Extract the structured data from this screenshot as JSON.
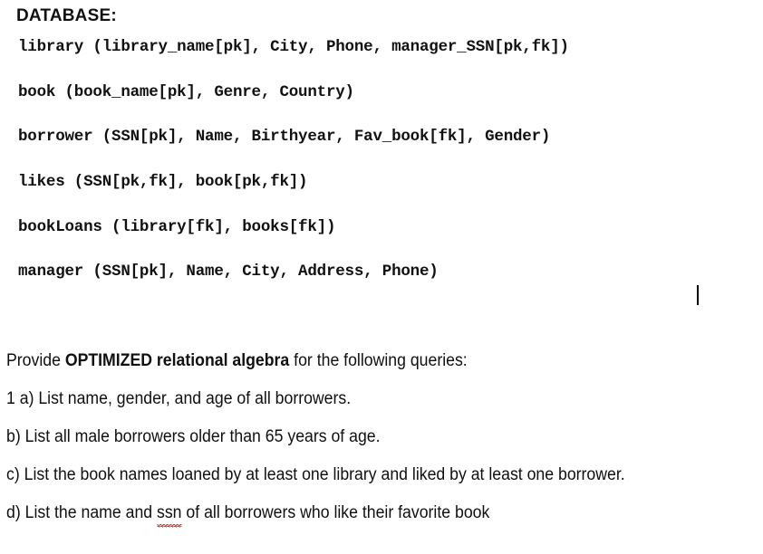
{
  "document": {
    "background_color": "#ffffff",
    "text_color": "#101010"
  },
  "schema": {
    "heading": "DATABASE:",
    "relations": [
      {
        "name": "library",
        "line": "library (library_name[pk], City, Phone, manager_SSN[pk,fk])"
      },
      {
        "name": "book",
        "line": "book (book_name[pk], Genre, Country)"
      },
      {
        "name": "borrower",
        "line": "borrower (SSN[pk], Name, Birthyear, Fav_book[fk], Gender)"
      },
      {
        "name": "likes",
        "line": "likes (SSN[pk,fk], book[pk,fk])"
      },
      {
        "name": "bookLoans",
        "line": "bookLoans (library[fk], books[fk])"
      },
      {
        "name": "manager",
        "line": "manager (SSN[pk], Name, City, Address, Phone)"
      }
    ]
  },
  "caret": {
    "visible": true
  },
  "questions": {
    "prompt_prefix": "Provide ",
    "prompt_bold": "OPTIMIZED relational algebra",
    "prompt_suffix": " for the following queries:",
    "items": [
      {
        "label": "1 a)",
        "text": "1 a) List name, gender, and age of all borrowers."
      },
      {
        "label": "b)",
        "text": "b) List all male borrowers older than 65 years of age."
      },
      {
        "label": "c)",
        "text": "c) List the book names loaned by at least one library and liked by at least one borrower."
      }
    ],
    "item_d": {
      "label": "d)",
      "before": "d) List the name and ",
      "misspelled_word": "ssn",
      "after": " of all borrowers who like their favorite book",
      "spellcheck_color": "#c0392b"
    }
  }
}
